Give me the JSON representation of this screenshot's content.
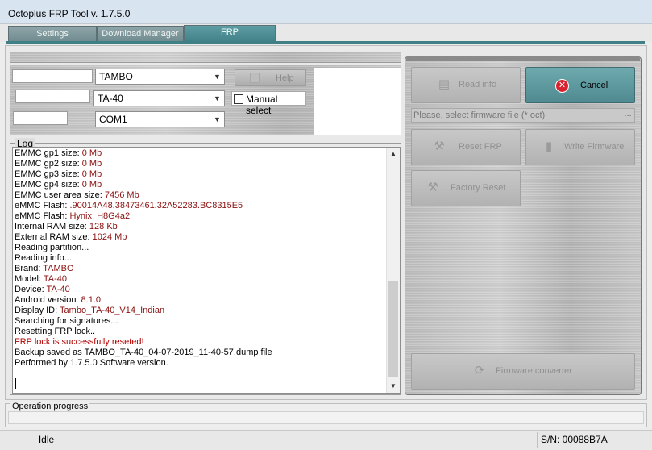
{
  "window": {
    "title": "Octoplus FRP Tool v. 1.7.5.0"
  },
  "tabs": [
    {
      "label": "Settings"
    },
    {
      "label": "Download Manager"
    },
    {
      "label": "FRP"
    }
  ],
  "selectors": {
    "brand": "TAMBO",
    "model": "TA-40",
    "port": "COM1",
    "help_label": "Help",
    "manual_select_label": "Manual select"
  },
  "log": {
    "label": "Log",
    "lines": [
      {
        "k": "EMMC gp1 size: ",
        "v": "0 Mb"
      },
      {
        "k": "EMMC gp2 size: ",
        "v": "0 Mb"
      },
      {
        "k": "EMMC gp3 size: ",
        "v": "0 Mb"
      },
      {
        "k": "EMMC gp4 size: ",
        "v": "0 Mb"
      },
      {
        "k": "EMMC user area size: ",
        "v": "7456 Mb"
      },
      {
        "k": "eMMC Flash: ",
        "v": ".90014A48.38473461.32A52283.BC8315E5"
      },
      {
        "k": "eMMC Flash: ",
        "v": "Hynix: H8G4a2"
      },
      {
        "k": "Internal RAM size: ",
        "v": "128 Kb"
      },
      {
        "k": "External RAM size: ",
        "v": "1024 Mb"
      },
      {
        "k": "Reading partition...",
        "v": ""
      },
      {
        "k": "Reading info...",
        "v": ""
      },
      {
        "k": "Brand: ",
        "v": "TAMBO"
      },
      {
        "k": "Model: ",
        "v": "TA-40"
      },
      {
        "k": "Device: ",
        "v": "TA-40"
      },
      {
        "k": "Android version: ",
        "v": "8.1.0"
      },
      {
        "k": "Display ID: ",
        "v": "Tambo_TA-40_V14_Indian"
      },
      {
        "k": "Searching for signatures...",
        "v": ""
      },
      {
        "k": "Resetting FRP lock..",
        "v": ""
      },
      {
        "k": "",
        "v": "FRP lock is successfully reseted!",
        "red": true
      },
      {
        "k": "Backup saved as TAMBO_TA-40_04-07-2019_11-40-57.dump file",
        "v": ""
      },
      {
        "k": "Performed by 1.7.5.0 Software version.",
        "v": ""
      }
    ]
  },
  "actions": {
    "read_info": "Read info",
    "cancel": "Cancel",
    "firmware_placeholder": "Please, select firmware file (*.oct)",
    "browse": "...",
    "reset_frp": "Reset FRP",
    "write_firmware": "Write Firmware",
    "factory_reset": "Factory Reset",
    "firmware_converter": "Firmware converter"
  },
  "progress": {
    "label": "Operation progress",
    "value": 0
  },
  "status": {
    "state": "Idle",
    "serial": "S/N: 00088B7A"
  },
  "colors": {
    "accent": "#4f8a90",
    "log_value": "#8b1010",
    "cancel_icon": "#d8232f"
  }
}
